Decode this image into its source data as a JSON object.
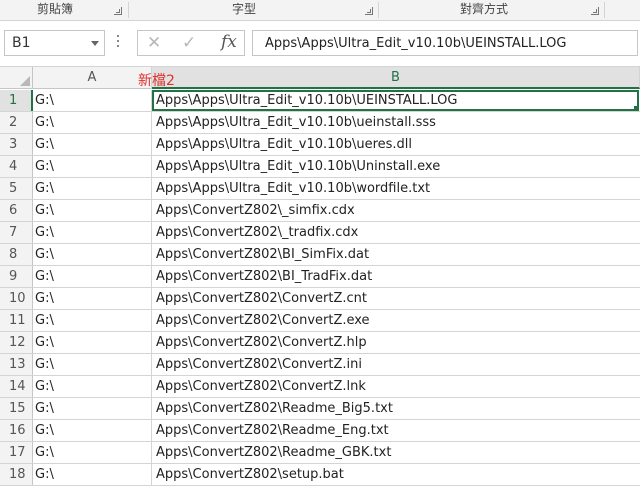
{
  "ribbon": {
    "groups": [
      {
        "label": "剪貼簿"
      },
      {
        "label": "字型"
      },
      {
        "label": "對齊方式"
      }
    ]
  },
  "formula_bar": {
    "name_box": "B1",
    "cancel_icon": "x-icon",
    "enter_icon": "check-icon",
    "function_label": "fx",
    "formula": "Apps\\Apps\\Ultra_Edit_v10.10b\\UEINSTALL.LOG"
  },
  "columns": [
    {
      "label": "A"
    },
    {
      "label": "B"
    }
  ],
  "annotation": "新檔2",
  "rows": [
    {
      "num": "1",
      "a": "G:\\",
      "b": "Apps\\Apps\\Ultra_Edit_v10.10b\\UEINSTALL.LOG"
    },
    {
      "num": "2",
      "a": "G:\\",
      "b": "Apps\\Apps\\Ultra_Edit_v10.10b\\ueinstall.sss"
    },
    {
      "num": "3",
      "a": "G:\\",
      "b": "Apps\\Apps\\Ultra_Edit_v10.10b\\ueres.dll"
    },
    {
      "num": "4",
      "a": "G:\\",
      "b": "Apps\\Apps\\Ultra_Edit_v10.10b\\Uninstall.exe"
    },
    {
      "num": "5",
      "a": "G:\\",
      "b": "Apps\\Apps\\Ultra_Edit_v10.10b\\wordfile.txt"
    },
    {
      "num": "6",
      "a": "G:\\",
      "b": "Apps\\ConvertZ802\\_simfix.cdx"
    },
    {
      "num": "7",
      "a": "G:\\",
      "b": "Apps\\ConvertZ802\\_tradfix.cdx"
    },
    {
      "num": "8",
      "a": "G:\\",
      "b": "Apps\\ConvertZ802\\BI_SimFix.dat"
    },
    {
      "num": "9",
      "a": "G:\\",
      "b": "Apps\\ConvertZ802\\BI_TradFix.dat"
    },
    {
      "num": "10",
      "a": "G:\\",
      "b": "Apps\\ConvertZ802\\ConvertZ.cnt"
    },
    {
      "num": "11",
      "a": "G:\\",
      "b": "Apps\\ConvertZ802\\ConvertZ.exe"
    },
    {
      "num": "12",
      "a": "G:\\",
      "b": "Apps\\ConvertZ802\\ConvertZ.hlp"
    },
    {
      "num": "13",
      "a": "G:\\",
      "b": "Apps\\ConvertZ802\\ConvertZ.ini"
    },
    {
      "num": "14",
      "a": "G:\\",
      "b": "Apps\\ConvertZ802\\ConvertZ.lnk"
    },
    {
      "num": "15",
      "a": "G:\\",
      "b": "Apps\\ConvertZ802\\Readme_Big5.txt"
    },
    {
      "num": "16",
      "a": "G:\\",
      "b": "Apps\\ConvertZ802\\Readme_Eng.txt"
    },
    {
      "num": "17",
      "a": "G:\\",
      "b": "Apps\\ConvertZ802\\Readme_GBK.txt"
    },
    {
      "num": "18",
      "a": "G:\\",
      "b": "Apps\\ConvertZ802\\setup.bat"
    }
  ],
  "selection": {
    "cell": "B1",
    "accent": "#217346"
  }
}
